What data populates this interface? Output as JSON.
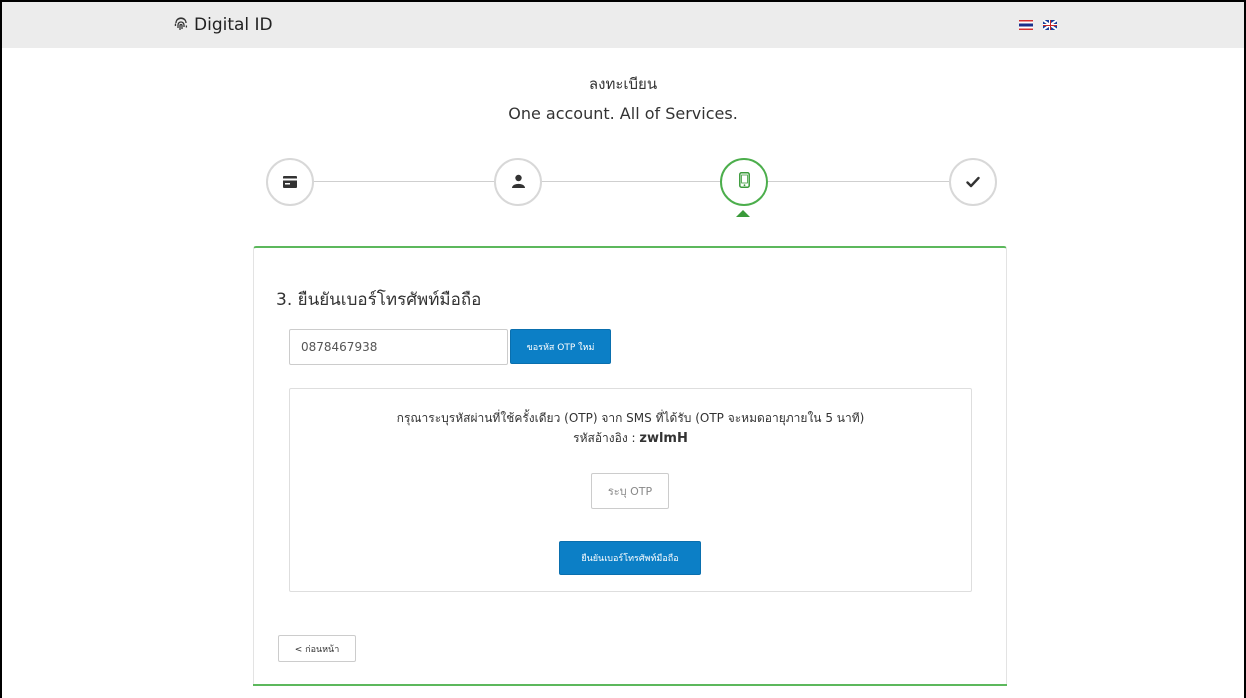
{
  "header": {
    "brand_name": "Digital ID",
    "brand_icon": "fingerprint-icon",
    "languages": [
      {
        "code": "th",
        "icon": "thai-flag-icon"
      },
      {
        "code": "en",
        "icon": "uk-flag-icon"
      }
    ]
  },
  "page": {
    "title": "ลงทะเบียน",
    "subtitle": "One account. All of Services."
  },
  "stepper": {
    "steps": [
      {
        "icon": "id-card-icon",
        "active": false
      },
      {
        "icon": "user-icon",
        "active": false
      },
      {
        "icon": "mobile-phone-icon",
        "active": true
      },
      {
        "icon": "checkmark-icon",
        "active": false
      }
    ],
    "active_index": 2
  },
  "colors": {
    "accent_green": "#5cb85c",
    "primary_blue": "#0c7fc6",
    "topbar_bg": "#ececec"
  },
  "form": {
    "heading": "3. ยืนยันเบอร์โทรศัพท์มือถือ",
    "phone_value": "0878467938",
    "request_otp_label": "ขอรหัส OTP ใหม่",
    "otp_instruction": "กรุณาระบุรหัสผ่านที่ใช้ครั้งเดียว (OTP) จาก SMS ที่ได้รับ (OTP จะหมดอายุภายใน 5 นาที)",
    "ref_label": "รหัสอ้างอิง : ",
    "ref_code": "zwlmH",
    "otp_placeholder": "ระบุ OTP",
    "confirm_label": "ยืนยันเบอร์โทรศัพท์มือถือ",
    "back_label": "< ก่อนหน้า"
  }
}
